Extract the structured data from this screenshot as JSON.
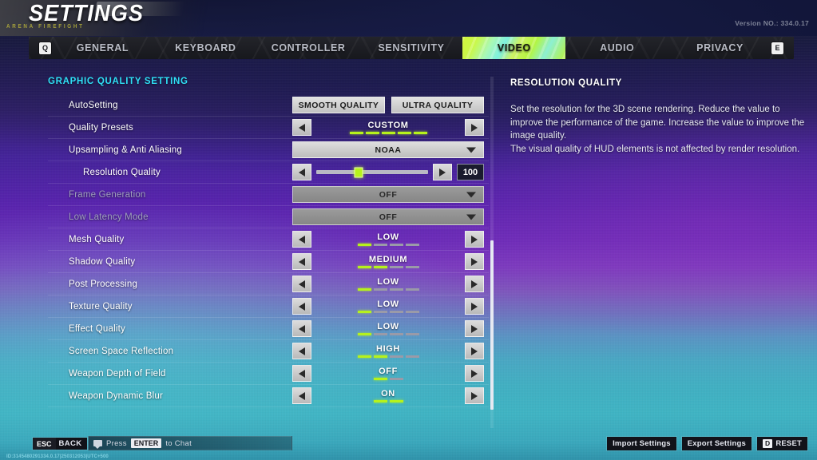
{
  "header": {
    "title": "SETTINGS",
    "subtitle": "ARENA FIREFIGHT",
    "version": "Version NO.: 334.0.17"
  },
  "tabs": {
    "key_left": "Q",
    "key_right": "E",
    "items": [
      {
        "label": "GENERAL",
        "active": false
      },
      {
        "label": "KEYBOARD",
        "active": false
      },
      {
        "label": "CONTROLLER",
        "active": false
      },
      {
        "label": "SENSITIVITY",
        "active": false
      },
      {
        "label": "VIDEO",
        "active": true
      },
      {
        "label": "AUDIO",
        "active": false
      },
      {
        "label": "PRIVACY",
        "active": false
      }
    ]
  },
  "settings": {
    "section_title": "GRAPHIC QUALITY SETTING",
    "rows": [
      {
        "label": "AutoSetting",
        "type": "buttons",
        "buttons": [
          "SMOOTH QUALITY",
          "ULTRA QUALITY"
        ]
      },
      {
        "label": "Quality Presets",
        "type": "stepper",
        "value": "CUSTOM",
        "segments_total": 5,
        "segments_on": 5
      },
      {
        "label": "Upsampling & Anti Aliasing",
        "type": "dropdown",
        "value": "NOAA",
        "disabled": false
      },
      {
        "label": "Resolution Quality",
        "type": "slider",
        "value": "100",
        "percent": 38,
        "indent": true
      },
      {
        "label": "Frame Generation",
        "type": "dropdown",
        "value": "OFF",
        "disabled": true
      },
      {
        "label": "Low Latency Mode",
        "type": "dropdown",
        "value": "OFF",
        "disabled": true
      },
      {
        "label": "Mesh Quality",
        "type": "stepper",
        "value": "LOW",
        "segments_total": 4,
        "segments_on": 1
      },
      {
        "label": "Shadow Quality",
        "type": "stepper",
        "value": "MEDIUM",
        "segments_total": 4,
        "segments_on": 2
      },
      {
        "label": "Post Processing",
        "type": "stepper",
        "value": "LOW",
        "segments_total": 4,
        "segments_on": 1
      },
      {
        "label": "Texture Quality",
        "type": "stepper",
        "value": "LOW",
        "segments_total": 4,
        "segments_on": 1
      },
      {
        "label": "Effect Quality",
        "type": "stepper",
        "value": "LOW",
        "segments_total": 4,
        "segments_on": 1
      },
      {
        "label": "Screen Space Reflection",
        "type": "stepper",
        "value": "HIGH",
        "segments_total": 4,
        "segments_on": 2
      },
      {
        "label": "Weapon Depth of Field",
        "type": "stepper",
        "value": "OFF",
        "segments_total": 2,
        "segments_on": 1
      },
      {
        "label": "Weapon Dynamic Blur",
        "type": "stepper",
        "value": "ON",
        "segments_total": 2,
        "segments_on": 2
      }
    ]
  },
  "description": {
    "title": "RESOLUTION QUALITY",
    "paragraphs": [
      "Set the resolution for the 3D scene rendering. Reduce the value to improve the performance of the game. Increase the value to improve the image quality.",
      "The visual quality of HUD elements is not affected by render resolution."
    ]
  },
  "footer": {
    "esc_key": "ESC",
    "back_label": "BACK",
    "chat_prefix": "Press",
    "chat_key": "ENTER",
    "chat_suffix": "to Chat",
    "build_id": "ID:3145480291334.0.17|250312053|UTC+500",
    "import_label": "Import Settings",
    "export_label": "Export Settings",
    "reset_key": "D",
    "reset_label": "RESET"
  },
  "colors": {
    "accent_green": "#b6f21c",
    "section_cyan": "#2fe0f7"
  }
}
